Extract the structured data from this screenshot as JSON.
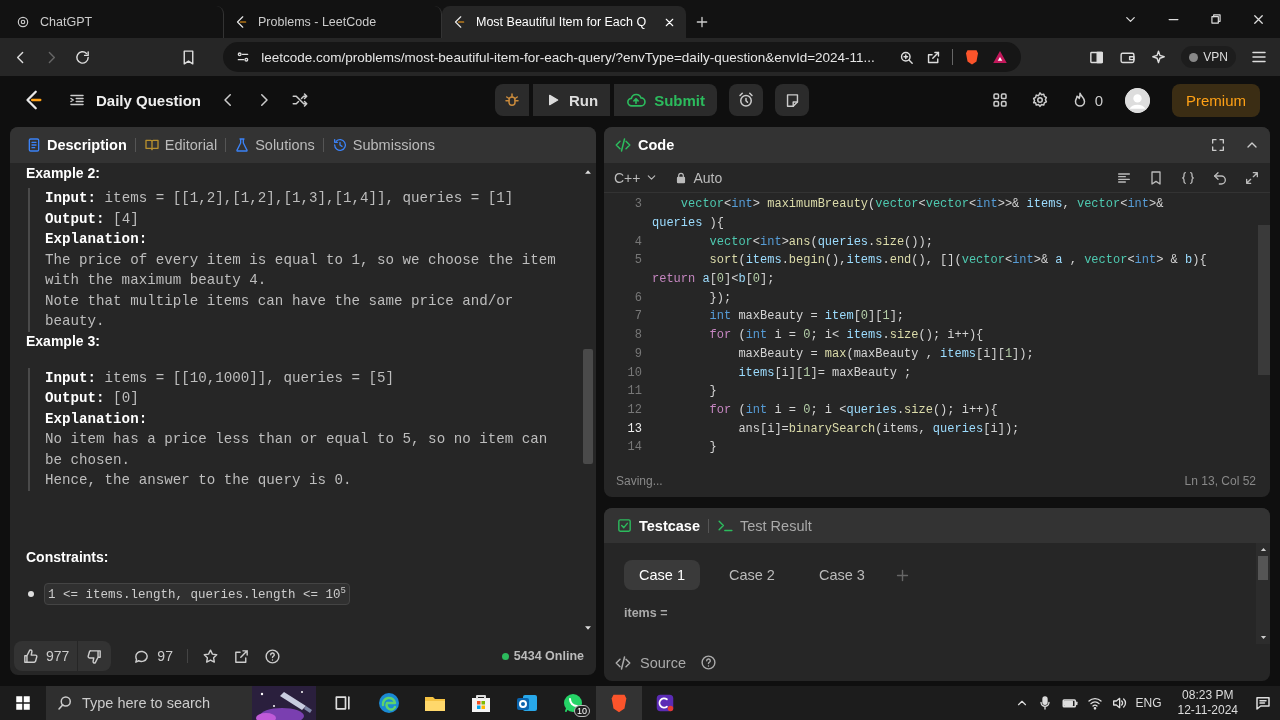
{
  "browser": {
    "tabs": [
      {
        "label": "ChatGPT",
        "selected": false
      },
      {
        "label": "Problems - LeetCode",
        "selected": false
      },
      {
        "label": "Most Beautiful Item for Each Q",
        "selected": true
      }
    ],
    "forward_disabled": true,
    "url": "leetcode.com/problems/most-beautiful-item-for-each-query/?envType=daily-question&envId=2024-11...",
    "vpn": "VPN"
  },
  "nav": {
    "title": "Daily Question",
    "run": "Run",
    "submit": "Submit",
    "streak": "0",
    "premium": "Premium"
  },
  "description": {
    "tabs": [
      {
        "label": "Description",
        "selected": true
      },
      {
        "label": "Editorial",
        "selected": false
      },
      {
        "label": "Solutions",
        "selected": false
      },
      {
        "label": "Submissions",
        "selected": false
      }
    ],
    "examples": [
      {
        "heading": "Example 2:",
        "lines": [
          {
            "kind": "io",
            "text": "**Input:** items = [[1,2],[1,2],[1,3],[1,4]], queries = [1]"
          },
          {
            "kind": "io",
            "text": "**Output:** [4]"
          },
          {
            "kind": "label",
            "text": "Explanation:"
          },
          {
            "kind": "prose",
            "text": "The price of every item is equal to 1, so we choose the item with the maximum beauty 4."
          },
          {
            "kind": "prose",
            "text": "Note that multiple items can have the same price and/or beauty."
          }
        ]
      },
      {
        "heading": "Example 3:",
        "lines": [
          {
            "kind": "io",
            "text": "**Input:** items = [[10,1000]], queries = [5]"
          },
          {
            "kind": "io",
            "text": "**Output:** [0]"
          },
          {
            "kind": "label",
            "text": "Explanation:"
          },
          {
            "kind": "prose",
            "text": "No item has a price less than or equal to 5, so no item can be chosen."
          },
          {
            "kind": "prose",
            "text": "Hence, the answer to the query is 0."
          }
        ]
      }
    ],
    "constraints_heading": "Constraints:",
    "constraints": [
      "1 <= items.length, queries.length <= 10$^{5}$"
    ],
    "footer": {
      "likes": "977",
      "comments": "97",
      "online": "5434 Online"
    }
  },
  "code": {
    "title": "Code",
    "language": "C++",
    "mode": "Auto",
    "lines": [
      {
        "number": "3",
        "current": false,
        "segments": [
          {
            "text": "    vector",
            "kind": "type"
          },
          {
            "text": "<",
            "kind": "plain"
          },
          {
            "text": "int",
            "kind": "keyword"
          },
          {
            "text": "> ",
            "kind": "plain"
          },
          {
            "text": "maximumBreauty",
            "kind": "function"
          },
          {
            "text": "(",
            "kind": "plain"
          },
          {
            "text": "vector",
            "kind": "type"
          },
          {
            "text": "<",
            "kind": "plain"
          },
          {
            "text": "vector",
            "kind": "type"
          },
          {
            "text": "<",
            "kind": "plain"
          },
          {
            "text": "int",
            "kind": "keyword"
          },
          {
            "text": ">>& ",
            "kind": "plain"
          },
          {
            "text": "items",
            "kind": "variable"
          },
          {
            "text": ", ",
            "kind": "plain"
          },
          {
            "text": "vector",
            "kind": "type"
          },
          {
            "text": "<",
            "kind": "plain"
          },
          {
            "text": "int",
            "kind": "keyword"
          },
          {
            "text": ">&",
            "kind": "plain"
          }
        ]
      },
      {
        "segments": [
          {
            "text": "queries",
            "kind": "variable"
          },
          {
            "text": " ){",
            "kind": "plain"
          }
        ]
      },
      {
        "number": "4",
        "current": false,
        "segments": [
          {
            "text": "        vector",
            "kind": "type"
          },
          {
            "text": "<",
            "kind": "plain"
          },
          {
            "text": "int",
            "kind": "keyword"
          },
          {
            "text": ">",
            "kind": "plain"
          },
          {
            "text": "ans",
            "kind": "function"
          },
          {
            "text": "(",
            "kind": "plain"
          },
          {
            "text": "queries",
            "kind": "variable"
          },
          {
            "text": ".",
            "kind": "plain"
          },
          {
            "text": "size",
            "kind": "function"
          },
          {
            "text": "());",
            "kind": "plain"
          }
        ]
      },
      {
        "number": "5",
        "current": false,
        "segments": [
          {
            "text": "        sort",
            "kind": "function"
          },
          {
            "text": "(",
            "kind": "plain"
          },
          {
            "text": "items",
            "kind": "variable"
          },
          {
            "text": ".",
            "kind": "plain"
          },
          {
            "text": "begin",
            "kind": "function"
          },
          {
            "text": "(),",
            "kind": "plain"
          },
          {
            "text": "items",
            "kind": "variable"
          },
          {
            "text": ".",
            "kind": "plain"
          },
          {
            "text": "end",
            "kind": "function"
          },
          {
            "text": "(), [](",
            "kind": "plain"
          },
          {
            "text": "vector",
            "kind": "type"
          },
          {
            "text": "<",
            "kind": "plain"
          },
          {
            "text": "int",
            "kind": "keyword"
          },
          {
            "text": ">& ",
            "kind": "plain"
          },
          {
            "text": "a",
            "kind": "variable"
          },
          {
            "text": " , ",
            "kind": "plain"
          },
          {
            "text": "vector",
            "kind": "type"
          },
          {
            "text": "<",
            "kind": "plain"
          },
          {
            "text": "int",
            "kind": "keyword"
          },
          {
            "text": "> & ",
            "kind": "plain"
          },
          {
            "text": "b",
            "kind": "variable"
          },
          {
            "text": "){",
            "kind": "plain"
          }
        ]
      },
      {
        "segments": [
          {
            "text": "return",
            "kind": "control"
          },
          {
            "text": " a",
            "kind": "variable"
          },
          {
            "text": "[",
            "kind": "plain"
          },
          {
            "text": "0",
            "kind": "number"
          },
          {
            "text": "]<",
            "kind": "plain"
          },
          {
            "text": "b",
            "kind": "variable"
          },
          {
            "text": "[",
            "kind": "plain"
          },
          {
            "text": "0",
            "kind": "number"
          },
          {
            "text": "];",
            "kind": "plain"
          }
        ]
      },
      {
        "number": "6",
        "current": false,
        "segments": [
          {
            "text": "        });",
            "kind": "plain"
          }
        ]
      },
      {
        "number": "7",
        "current": false,
        "segments": [
          {
            "text": "        int",
            "kind": "keyword"
          },
          {
            "text": " maxBeauty = ",
            "kind": "plain"
          },
          {
            "text": "item",
            "kind": "variable"
          },
          {
            "text": "[",
            "kind": "plain"
          },
          {
            "text": "0",
            "kind": "number"
          },
          {
            "text": "][",
            "kind": "plain"
          },
          {
            "text": "1",
            "kind": "number"
          },
          {
            "text": "];",
            "kind": "plain"
          }
        ]
      },
      {
        "number": "8",
        "current": false,
        "segments": [
          {
            "text": "        for",
            "kind": "control"
          },
          {
            "text": " (",
            "kind": "plain"
          },
          {
            "text": "int",
            "kind": "keyword"
          },
          {
            "text": " i = ",
            "kind": "plain"
          },
          {
            "text": "0",
            "kind": "number"
          },
          {
            "text": "; i< ",
            "kind": "plain"
          },
          {
            "text": "items",
            "kind": "variable"
          },
          {
            "text": ".",
            "kind": "plain"
          },
          {
            "text": "size",
            "kind": "function"
          },
          {
            "text": "(); i++){",
            "kind": "plain"
          }
        ]
      },
      {
        "number": "9",
        "current": false,
        "segments": [
          {
            "text": "            maxBeauty = ",
            "kind": "plain"
          },
          {
            "text": "max",
            "kind": "function"
          },
          {
            "text": "(maxBeauty , ",
            "kind": "plain"
          },
          {
            "text": "items",
            "kind": "variable"
          },
          {
            "text": "[i][",
            "kind": "plain"
          },
          {
            "text": "1",
            "kind": "number"
          },
          {
            "text": "]);",
            "kind": "plain"
          }
        ]
      },
      {
        "number": "10",
        "current": false,
        "segments": [
          {
            "text": "            items",
            "kind": "variable"
          },
          {
            "text": "[i][",
            "kind": "plain"
          },
          {
            "text": "1",
            "kind": "number"
          },
          {
            "text": "]= maxBeauty ;",
            "kind": "plain"
          }
        ]
      },
      {
        "number": "11",
        "current": false,
        "segments": [
          {
            "text": "        }",
            "kind": "plain"
          }
        ]
      },
      {
        "number": "12",
        "current": false,
        "segments": [
          {
            "text": "        for",
            "kind": "control"
          },
          {
            "text": " (",
            "kind": "plain"
          },
          {
            "text": "int",
            "kind": "keyword"
          },
          {
            "text": " i = ",
            "kind": "plain"
          },
          {
            "text": "0",
            "kind": "number"
          },
          {
            "text": "; i <",
            "kind": "plain"
          },
          {
            "text": "queries",
            "kind": "variable"
          },
          {
            "text": ".",
            "kind": "plain"
          },
          {
            "text": "size",
            "kind": "function"
          },
          {
            "text": "(); i++){",
            "kind": "plain"
          }
        ]
      },
      {
        "number": "13",
        "current": true,
        "segments": [
          {
            "text": "            ans[i]=",
            "kind": "plain"
          },
          {
            "text": "binarySearch",
            "kind": "function"
          },
          {
            "text": "(items, ",
            "kind": "plain"
          },
          {
            "text": "queries",
            "kind": "variable"
          },
          {
            "text": "[i]);",
            "kind": "plain"
          }
        ]
      },
      {
        "number": "14",
        "current": false,
        "segments": [
          {
            "text": "        }",
            "kind": "plain"
          }
        ]
      }
    ],
    "status": "Saving...",
    "cursor": "Ln 13, Col 52"
  },
  "testcase": {
    "tabs": [
      {
        "label": "Testcase",
        "selected": true
      },
      {
        "label": "Test Result",
        "selected": false
      }
    ],
    "cases": [
      {
        "label": "Case 1",
        "selected": true
      },
      {
        "label": "Case 2",
        "selected": false
      },
      {
        "label": "Case 3",
        "selected": false
      }
    ],
    "param": "items =",
    "source": "Source"
  },
  "taskbar": {
    "search_placeholder": "Type here to search",
    "whatsapp_badge": "10",
    "language": "ENG",
    "time": "08:23 PM",
    "date": "12-11-2024"
  }
}
